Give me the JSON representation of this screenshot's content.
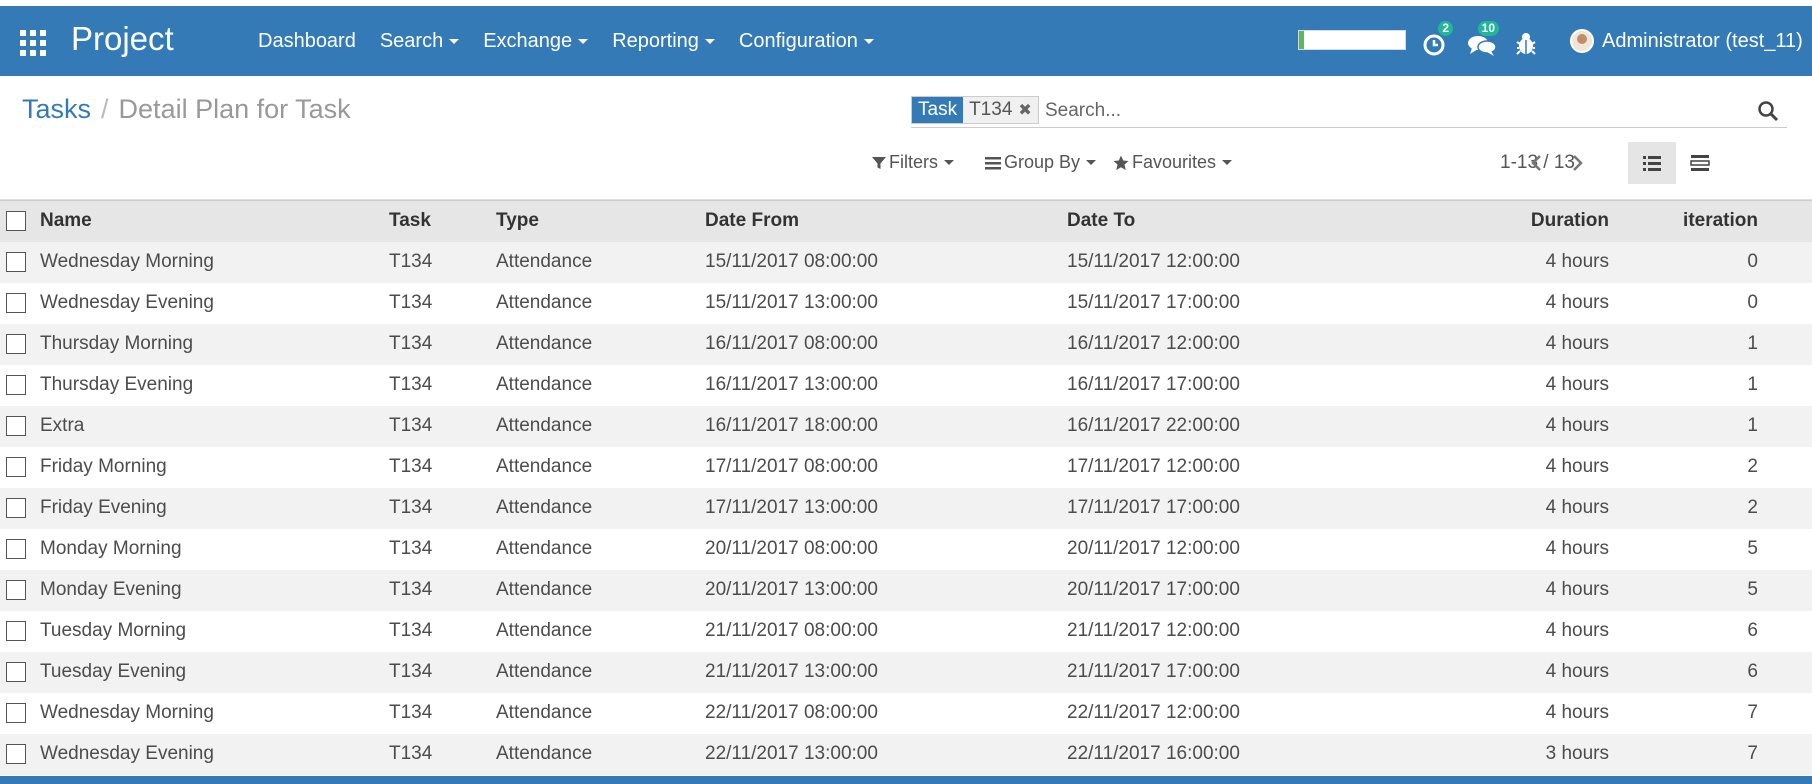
{
  "app": {
    "brand": "Project"
  },
  "menu": [
    {
      "label": "Dashboard",
      "has_caret": false
    },
    {
      "label": "Search",
      "has_caret": true
    },
    {
      "label": "Exchange",
      "has_caret": true
    },
    {
      "label": "Reporting",
      "has_caret": true
    },
    {
      "label": "Configuration",
      "has_caret": true
    }
  ],
  "systray": {
    "activity_badge": "2",
    "messages_badge": "10",
    "progress_fraction": 0.05,
    "user_name": "Administrator (test_11)"
  },
  "breadcrumb": {
    "parent": "Tasks",
    "separator": "/",
    "current": "Detail Plan for Task"
  },
  "search": {
    "facet_category": "Task",
    "facet_value": "T134",
    "facet_remove": "✖",
    "placeholder": "Search..."
  },
  "search_options": {
    "filters": "Filters",
    "group_by": "Group By",
    "favourites": "Favourites"
  },
  "pager": {
    "value": "1-13 / 13"
  },
  "table": {
    "headers": {
      "name": "Name",
      "task": "Task",
      "type": "Type",
      "date_from": "Date From",
      "date_to": "Date To",
      "duration": "Duration",
      "iteration": "iteration"
    },
    "rows": [
      {
        "name": "Wednesday Morning",
        "task": "T134",
        "type": "Attendance",
        "date_from": "15/11/2017 08:00:00",
        "date_to": "15/11/2017 12:00:00",
        "duration": "4 hours",
        "iteration": "0"
      },
      {
        "name": "Wednesday Evening",
        "task": "T134",
        "type": "Attendance",
        "date_from": "15/11/2017 13:00:00",
        "date_to": "15/11/2017 17:00:00",
        "duration": "4 hours",
        "iteration": "0"
      },
      {
        "name": "Thursday Morning",
        "task": "T134",
        "type": "Attendance",
        "date_from": "16/11/2017 08:00:00",
        "date_to": "16/11/2017 12:00:00",
        "duration": "4 hours",
        "iteration": "1"
      },
      {
        "name": "Thursday Evening",
        "task": "T134",
        "type": "Attendance",
        "date_from": "16/11/2017 13:00:00",
        "date_to": "16/11/2017 17:00:00",
        "duration": "4 hours",
        "iteration": "1"
      },
      {
        "name": "Extra",
        "task": "T134",
        "type": "Attendance",
        "date_from": "16/11/2017 18:00:00",
        "date_to": "16/11/2017 22:00:00",
        "duration": "4 hours",
        "iteration": "1"
      },
      {
        "name": "Friday Morning",
        "task": "T134",
        "type": "Attendance",
        "date_from": "17/11/2017 08:00:00",
        "date_to": "17/11/2017 12:00:00",
        "duration": "4 hours",
        "iteration": "2"
      },
      {
        "name": "Friday Evening",
        "task": "T134",
        "type": "Attendance",
        "date_from": "17/11/2017 13:00:00",
        "date_to": "17/11/2017 17:00:00",
        "duration": "4 hours",
        "iteration": "2"
      },
      {
        "name": "Monday Morning",
        "task": "T134",
        "type": "Attendance",
        "date_from": "20/11/2017 08:00:00",
        "date_to": "20/11/2017 12:00:00",
        "duration": "4 hours",
        "iteration": "5"
      },
      {
        "name": "Monday Evening",
        "task": "T134",
        "type": "Attendance",
        "date_from": "20/11/2017 13:00:00",
        "date_to": "20/11/2017 17:00:00",
        "duration": "4 hours",
        "iteration": "5"
      },
      {
        "name": "Tuesday Morning",
        "task": "T134",
        "type": "Attendance",
        "date_from": "21/11/2017 08:00:00",
        "date_to": "21/11/2017 12:00:00",
        "duration": "4 hours",
        "iteration": "6"
      },
      {
        "name": "Tuesday Evening",
        "task": "T134",
        "type": "Attendance",
        "date_from": "21/11/2017 13:00:00",
        "date_to": "21/11/2017 17:00:00",
        "duration": "4 hours",
        "iteration": "6"
      },
      {
        "name": "Wednesday Morning",
        "task": "T134",
        "type": "Attendance",
        "date_from": "22/11/2017 08:00:00",
        "date_to": "22/11/2017 12:00:00",
        "duration": "4 hours",
        "iteration": "7"
      },
      {
        "name": "Wednesday Evening",
        "task": "T134",
        "type": "Attendance",
        "date_from": "22/11/2017 13:00:00",
        "date_to": "22/11/2017 16:00:00",
        "duration": "3 hours",
        "iteration": "7"
      }
    ]
  },
  "icons": {
    "apps": "apps-grid-icon",
    "activity": "clock-icon",
    "messages": "chat-icon",
    "debug": "bug-icon",
    "search": "search-icon",
    "filter": "filter-icon",
    "group_by": "list-icon",
    "favourites": "star-icon",
    "prev": "chevron-left-icon",
    "next": "chevron-right-icon",
    "list_view": "list-view-icon",
    "kanban_view": "detail-view-icon"
  },
  "colors": {
    "navbar": "#337ab7",
    "badge": "#21b799",
    "progress": "#5cb85c",
    "row_alt": "#f2f2f2",
    "header_bg": "#e6e6e6"
  }
}
